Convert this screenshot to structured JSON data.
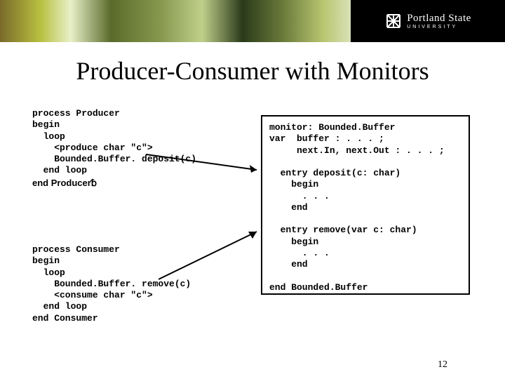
{
  "banner": {
    "logo_line1": "Portland State",
    "logo_line2": "UNIVERSITY"
  },
  "title": "Producer-Consumer with Monitors",
  "producer_code": "process Producer\nbegin\n  loop\n    <produce char \"c\">\n    Bounded.Buffer. deposit(c)\n  end loop",
  "producer_end": "end Producer␢",
  "consumer_code": "process Consumer\nbegin\n  loop\n    Bounded.Buffer. remove(c)\n    <consume char \"c\">\n  end loop\nend Consumer",
  "monitor_code": "monitor: Bounded.Buffer\nvar  buffer : . . . ;\n     next.In, next.Out : . . . ;\n\n  entry deposit(c: char)\n    begin\n      . . .\n    end\n\n  entry remove(var c: char)\n    begin\n      . . .\n    end\n\nend Bounded.Buffer",
  "pagenum": "12"
}
